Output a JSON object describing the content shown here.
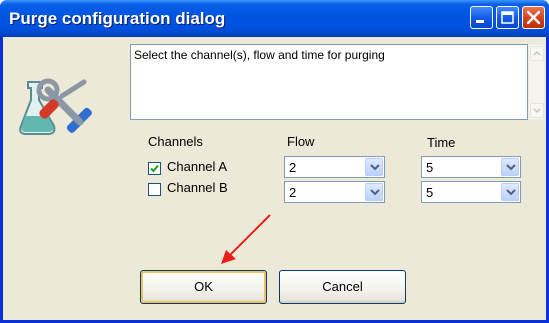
{
  "window": {
    "title": "Purge configuration dialog",
    "title_buttons": [
      "minimize",
      "maximize",
      "close"
    ]
  },
  "icon": "flask-tools-icon",
  "description": "Select the channel(s), flow and time for purging",
  "headers": {
    "channels": "Channels",
    "flow": "Flow",
    "time": "Time"
  },
  "channels": [
    {
      "label": "Channel A",
      "checked": true,
      "flow": "2",
      "time": "5"
    },
    {
      "label": "Channel B",
      "checked": false,
      "flow": "2",
      "time": "5"
    }
  ],
  "buttons": {
    "ok": "OK",
    "cancel": "Cancel"
  },
  "colors": {
    "titlebar": "#0054e3",
    "window_frame": "#0831d9",
    "dialog_bg": "#ece9d8",
    "close_button": "#d3421b",
    "annotation_arrow": "#e8201a"
  }
}
